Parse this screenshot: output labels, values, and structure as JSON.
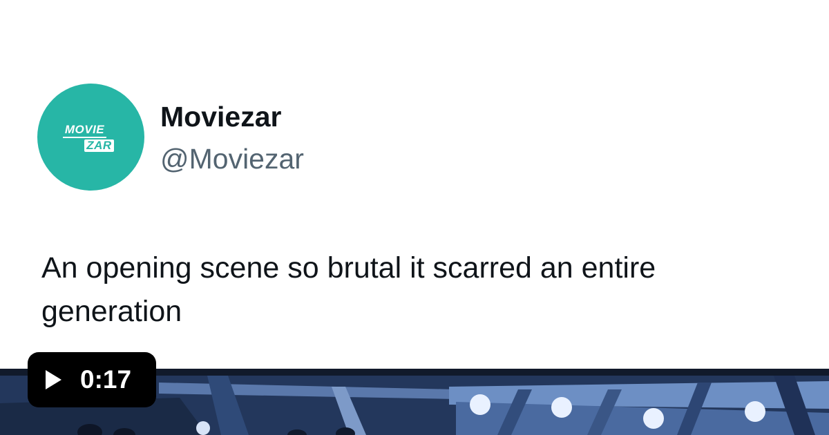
{
  "tweet": {
    "display_name": "Moviezar",
    "handle": "@Moviezar",
    "text": "An opening scene so brutal it scarred an entire generation"
  },
  "avatar": {
    "logo_line1": "MOVIE",
    "logo_line2": "ZAR",
    "color": "#27b6a6"
  },
  "video": {
    "duration": "0:17",
    "play_icon": "play-icon"
  },
  "colors": {
    "text_primary": "#0f1419",
    "text_secondary": "#536471",
    "brand_teal": "#27b6a6",
    "chip_background": "#000000"
  }
}
